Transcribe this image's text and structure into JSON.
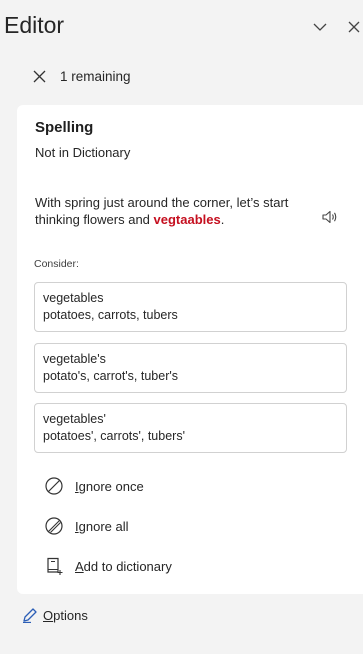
{
  "header": {
    "title": "Editor"
  },
  "remaining": {
    "text": "1 remaining"
  },
  "card": {
    "title": "Spelling",
    "subtitle": "Not in Dictionary",
    "context": {
      "before": "With spring just around the corner, let’s start thinking flowers and ",
      "misspelled": "vegtaables",
      "after": "."
    },
    "consider_label": "Consider:",
    "suggestions": [
      {
        "word": "vegetables",
        "examples": "potatoes, carrots, tubers"
      },
      {
        "word": "vegetable's",
        "examples": "potato's, carrot's, tuber's"
      },
      {
        "word": "vegetables'",
        "examples": "potatoes', carrots', tubers'"
      }
    ],
    "actions": {
      "ignore_once": {
        "first": "I",
        "rest": "gnore once"
      },
      "ignore_all": {
        "first": "I",
        "rest": "gnore all"
      },
      "add_dictionary": {
        "first": "A",
        "rest": "dd to dictionary"
      }
    }
  },
  "options": {
    "first": "O",
    "rest": "ptions"
  },
  "colors": {
    "misspelled": "#c50f1f",
    "background": "#f3f3f3",
    "card": "#ffffff",
    "icon_blue": "#2b5eb6"
  },
  "icons": [
    "chevron-down-icon",
    "close-icon",
    "speaker-icon",
    "ignore-once-icon",
    "ignore-all-icon",
    "add-dictionary-icon",
    "options-pen-icon"
  ]
}
